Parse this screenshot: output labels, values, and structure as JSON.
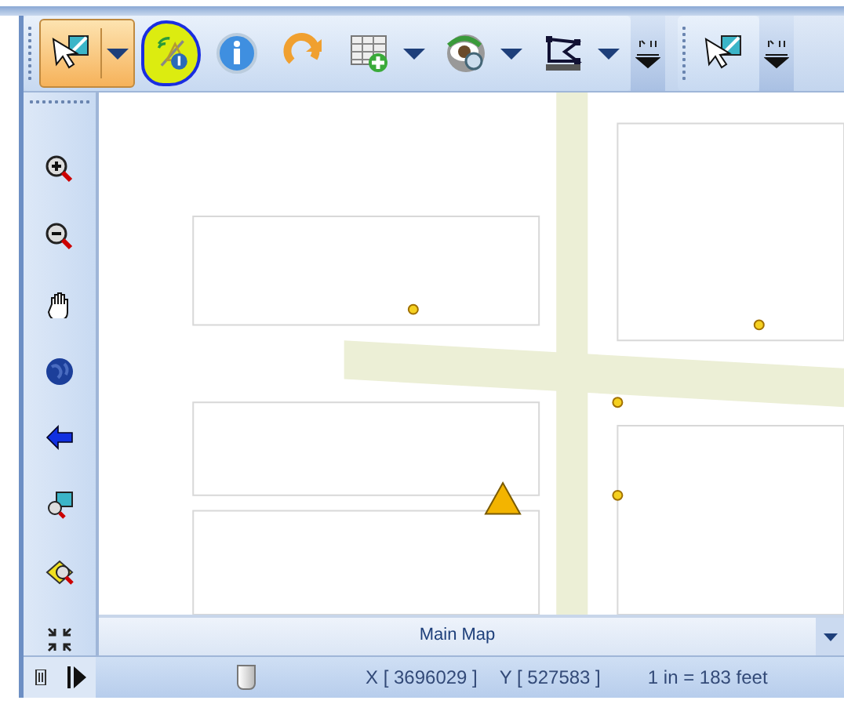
{
  "toolbar": {
    "tools": [
      {
        "kind": "pointer",
        "selected": true,
        "highlighted": false,
        "dropdown": true
      },
      {
        "kind": "gps",
        "selected": false,
        "highlighted": true,
        "dropdown": false
      },
      {
        "kind": "info",
        "selected": false,
        "highlighted": false,
        "dropdown": false
      },
      {
        "kind": "refresh",
        "selected": false,
        "highlighted": false,
        "dropdown": false
      },
      {
        "kind": "table",
        "selected": false,
        "highlighted": false,
        "dropdown": true
      },
      {
        "kind": "eye",
        "selected": false,
        "highlighted": false,
        "dropdown": true
      },
      {
        "kind": "vertex",
        "selected": false,
        "highlighted": false,
        "dropdown": true
      }
    ],
    "second_tools": [
      {
        "kind": "pointer",
        "selected": false,
        "highlighted": false,
        "dropdown": false
      }
    ]
  },
  "side_toolbar": {
    "tools": [
      {
        "kind": "zoom-in"
      },
      {
        "kind": "zoom-out"
      },
      {
        "kind": "pan"
      },
      {
        "kind": "globe"
      },
      {
        "kind": "back"
      },
      {
        "kind": "zoom-select"
      },
      {
        "kind": "zoom-layer"
      },
      {
        "kind": "extent"
      }
    ]
  },
  "map_tab": {
    "label": "Main Map"
  },
  "status_bar": {
    "x": "X [ 3696029 ]",
    "y": "Y [ 527583 ]",
    "scale": "1 in = 183 feet"
  }
}
